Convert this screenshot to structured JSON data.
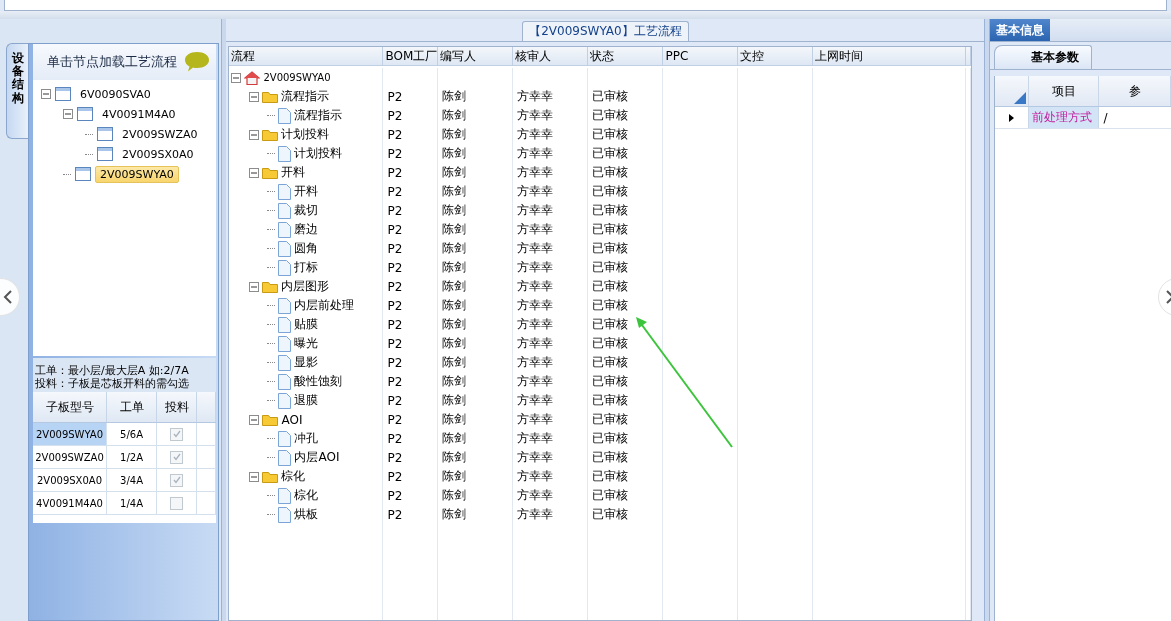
{
  "left_panel": {
    "side_tab": {
      "label": "设备结构",
      "selected": true
    },
    "header": "单击节点加载工艺流程",
    "tree": [
      {
        "label": "6V0090SVA0",
        "expanded": true,
        "selected": false,
        "children": [
          {
            "label": "4V0091M4A0",
            "expanded": true,
            "selected": false,
            "children": [
              {
                "label": "2V009SWZA0",
                "selected": false
              },
              {
                "label": "2V009SX0A0",
                "selected": false
              }
            ]
          },
          {
            "label": "2V009SWYA0",
            "selected": true
          }
        ]
      }
    ],
    "hint_lines": [
      "工单：最小层/最大层A 如:2/7A",
      "投料：子板是芯板开料的需勾选"
    ],
    "subboard_table": {
      "columns": [
        "子板型号",
        "工单",
        "投料"
      ],
      "rows": [
        {
          "model": "2V009SWYA0",
          "order": "5/6A",
          "feed_checked": true,
          "feed_disabled": true,
          "selected": true
        },
        {
          "model": "2V009SWZA0",
          "order": "1/2A",
          "feed_checked": true,
          "feed_disabled": true,
          "selected": false
        },
        {
          "model": "2V009SX0A0",
          "order": "3/4A",
          "feed_checked": true,
          "feed_disabled": true,
          "selected": false
        },
        {
          "model": "4V0091M4A0",
          "order": "1/4A",
          "feed_checked": false,
          "feed_disabled": true,
          "selected": false
        }
      ]
    }
  },
  "process_panel": {
    "title": "【2V009SWYA0】工艺流程",
    "columns": [
      "流程",
      "BOM工厂",
      "编写人",
      "核审人",
      "状态",
      "PPC",
      "文控",
      "上网时间"
    ],
    "tree": [
      {
        "kind": "root",
        "label": "2V009SWYA0",
        "expanded": true,
        "children": [
          {
            "kind": "folder",
            "label": "流程指示",
            "expanded": true,
            "cells": [
              "P2",
              "陈剑",
              "方幸幸",
              "已审核"
            ],
            "children": [
              {
                "kind": "file",
                "label": "流程指示",
                "cells": [
                  "P2",
                  "陈剑",
                  "方幸幸",
                  "已审核"
                ]
              }
            ]
          },
          {
            "kind": "folder",
            "label": "计划投料",
            "expanded": true,
            "cells": [
              "P2",
              "陈剑",
              "方幸幸",
              "已审核"
            ],
            "children": [
              {
                "kind": "file",
                "label": "计划投料",
                "cells": [
                  "P2",
                  "陈剑",
                  "方幸幸",
                  "已审核"
                ]
              }
            ]
          },
          {
            "kind": "folder",
            "label": "开料",
            "expanded": true,
            "cells": [
              "P2",
              "陈剑",
              "方幸幸",
              "已审核"
            ],
            "children": [
              {
                "kind": "file",
                "label": "开料",
                "cells": [
                  "P2",
                  "陈剑",
                  "方幸幸",
                  "已审核"
                ]
              },
              {
                "kind": "file",
                "label": "裁切",
                "cells": [
                  "P2",
                  "陈剑",
                  "方幸幸",
                  "已审核"
                ]
              },
              {
                "kind": "file",
                "label": "磨边",
                "cells": [
                  "P2",
                  "陈剑",
                  "方幸幸",
                  "已审核"
                ]
              },
              {
                "kind": "file",
                "label": "圆角",
                "cells": [
                  "P2",
                  "陈剑",
                  "方幸幸",
                  "已审核"
                ]
              },
              {
                "kind": "file",
                "label": "打标",
                "cells": [
                  "P2",
                  "陈剑",
                  "方幸幸",
                  "已审核"
                ]
              }
            ]
          },
          {
            "kind": "folder",
            "label": "内层图形",
            "expanded": true,
            "cells": [
              "P2",
              "陈剑",
              "方幸幸",
              "已审核"
            ],
            "children": [
              {
                "kind": "file",
                "label": "内层前处理",
                "cells": [
                  "P2",
                  "陈剑",
                  "方幸幸",
                  "已审核"
                ]
              },
              {
                "kind": "file",
                "label": "贴膜",
                "cells": [
                  "P2",
                  "陈剑",
                  "方幸幸",
                  "已审核"
                ]
              },
              {
                "kind": "file",
                "label": "曝光",
                "cells": [
                  "P2",
                  "陈剑",
                  "方幸幸",
                  "已审核"
                ]
              },
              {
                "kind": "file",
                "label": "显影",
                "cells": [
                  "P2",
                  "陈剑",
                  "方幸幸",
                  "已审核"
                ]
              },
              {
                "kind": "file",
                "label": "酸性蚀刻",
                "cells": [
                  "P2",
                  "陈剑",
                  "方幸幸",
                  "已审核"
                ]
              },
              {
                "kind": "file",
                "label": "退膜",
                "cells": [
                  "P2",
                  "陈剑",
                  "方幸幸",
                  "已审核"
                ]
              }
            ]
          },
          {
            "kind": "folder",
            "label": "AOI",
            "expanded": true,
            "cells": [
              "P2",
              "陈剑",
              "方幸幸",
              "已审核"
            ],
            "children": [
              {
                "kind": "file",
                "label": "冲孔",
                "cells": [
                  "P2",
                  "陈剑",
                  "方幸幸",
                  "已审核"
                ]
              },
              {
                "kind": "file",
                "label": "内层AOI",
                "cells": [
                  "P2",
                  "陈剑",
                  "方幸幸",
                  "已审核"
                ]
              }
            ]
          },
          {
            "kind": "folder",
            "label": "棕化",
            "expanded": true,
            "cells": [
              "P2",
              "陈剑",
              "方幸幸",
              "已审核"
            ],
            "children": [
              {
                "kind": "file",
                "label": "棕化",
                "cells": [
                  "P2",
                  "陈剑",
                  "方幸幸",
                  "已审核"
                ]
              },
              {
                "kind": "file",
                "label": "烘板",
                "cells": [
                  "P2",
                  "陈剑",
                  "方幸幸",
                  "已审核"
                ]
              }
            ]
          }
        ]
      }
    ]
  },
  "info_panel": {
    "tabs": [
      {
        "label": "基本信息",
        "selected": true
      }
    ],
    "sub_tabs": [
      {
        "label": "基本参数",
        "selected": true
      }
    ],
    "grid": {
      "columns": [
        "项目",
        "参"
      ],
      "rows": [
        {
          "item": "前处理方式",
          "value": "/",
          "current": true
        }
      ]
    }
  }
}
